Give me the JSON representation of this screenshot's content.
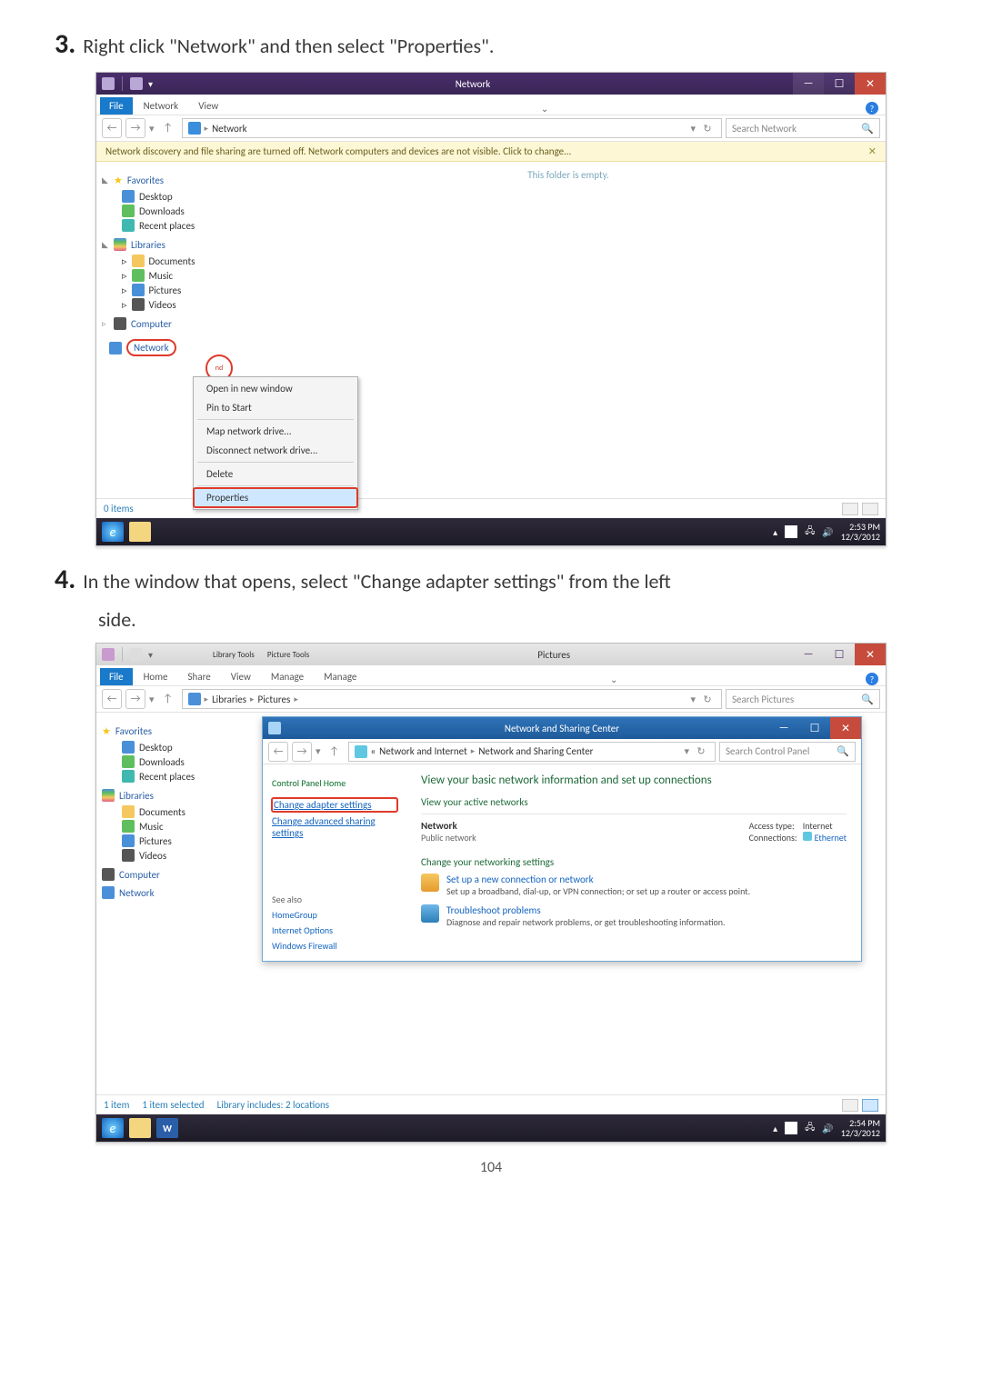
{
  "page_number": "104",
  "step3": {
    "num": "3.",
    "text": "Right click \"Network\" and then select \"Properties\"."
  },
  "step4": {
    "num": "4.",
    "text_line1": "In the window that opens, select \"Change adapter settings\" from the left",
    "text_line2": "side."
  },
  "shot1": {
    "title": "Network",
    "ribbon": {
      "file": "File",
      "network": "Network",
      "view": "View"
    },
    "breadcrumb": {
      "arrow": "▸",
      "network": "Network"
    },
    "search_placeholder": "Search Network",
    "info_bar": "Network discovery and file sharing are turned off. Network computers and devices are not visible. Click to change...",
    "sidebar": {
      "favorites": "Favorites",
      "desktop": "Desktop",
      "downloads": "Downloads",
      "recent": "Recent places",
      "libraries": "Libraries",
      "documents": "Documents",
      "music": "Music",
      "pictures": "Pictures",
      "videos": "Videos",
      "computer": "Computer",
      "network": "Network"
    },
    "context": {
      "expand_tail": "nd",
      "open_new": "Open in new window",
      "pin": "Pin to Start",
      "map": "Map network drive...",
      "disconnect": "Disconnect network drive...",
      "delete": "Delete",
      "properties": "Properties"
    },
    "empty": "This folder is empty.",
    "status_count": "0 items",
    "taskbar": {
      "time": "2:53 PM",
      "date": "12/3/2012"
    }
  },
  "shot2": {
    "title": "Pictures",
    "ribbon": {
      "file": "File",
      "home": "Home",
      "share": "Share",
      "view": "View",
      "manage_lib": "Library Tools",
      "manage_lib2": "Manage",
      "pic": "Picture Tools",
      "pic2": "Manage"
    },
    "breadcrumb": {
      "libraries": "Libraries",
      "pictures": "Pictures"
    },
    "search_placeholder": "Search Pictures",
    "sidebar": {
      "favorites": "Favorites",
      "desktop": "Desktop",
      "downloads": "Downloads",
      "recent": "Recent places",
      "libraries": "Libraries",
      "documents": "Documents",
      "music": "Music",
      "pictures": "Pictures",
      "videos": "Videos",
      "computer": "Computer",
      "network": "Network"
    },
    "subwin": {
      "title": "Network and Sharing Center",
      "crumb_prefix": "«",
      "crumb1": "Network and Internet",
      "crumb2": "Network and Sharing Center",
      "search_placeholder": "Search Control Panel",
      "cp_home": "Control Panel Home",
      "change_adapter": "Change adapter settings",
      "change_advanced": "Change advanced sharing settings",
      "heading": "View your basic network information and set up connections",
      "active_nets": "View your active networks",
      "net_name": "Network",
      "net_sub": "Public network",
      "access_label": "Access type:",
      "access_val": "Internet",
      "conn_label": "Connections:",
      "conn_val": "Ethernet",
      "change_settings": "Change your networking settings",
      "setup_title": "Set up a new connection or network",
      "setup_sub": "Set up a broadband, dial-up, or VPN connection; or set up a router or access point.",
      "trouble_title": "Troubleshoot problems",
      "trouble_sub": "Diagnose and repair network problems, or get troubleshooting information.",
      "see_also": "See also",
      "homegroup": "HomeGroup",
      "iopts": "Internet Options",
      "wfire": "Windows Firewall"
    },
    "status_items": "1 item",
    "status_sel": "1 item selected",
    "status_lib": "Library includes: 2 locations",
    "taskbar": {
      "time": "2:54 PM",
      "date": "12/3/2012"
    }
  }
}
